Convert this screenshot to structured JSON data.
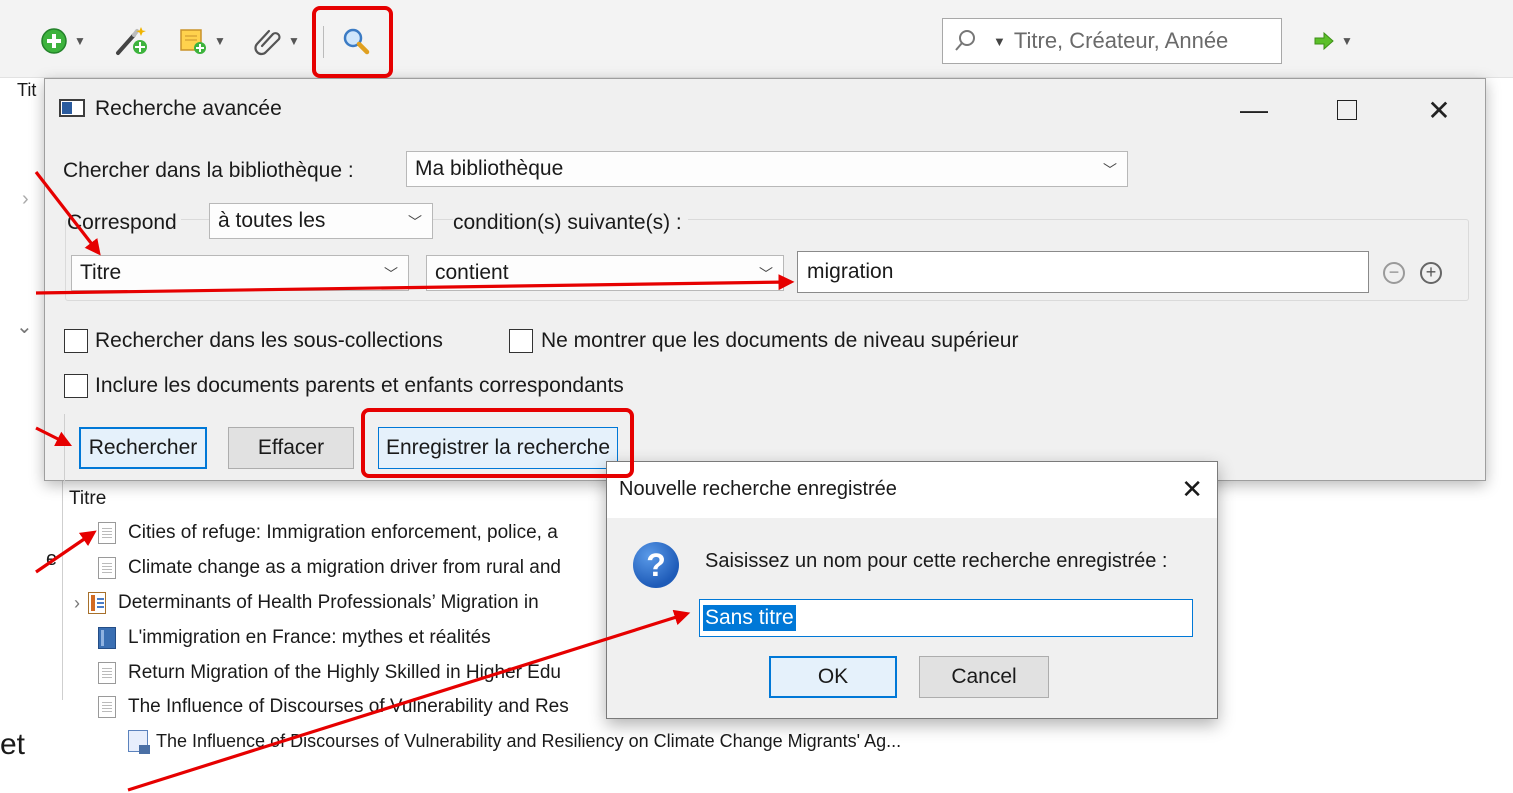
{
  "toolbar": {
    "search_placeholder": "Titre, Créateur, Année",
    "icons": [
      "new-item-icon",
      "magic-wand-icon",
      "new-note-icon",
      "attachment-icon",
      "advanced-search-icon",
      "search-mode-icon",
      "sync-arrow-icon"
    ]
  },
  "background": {
    "column_title_fragment": "Tit",
    "left_fragment_e": "e",
    "left_fragment_et": "et",
    "items_header": "Titre",
    "items": [
      {
        "title": "Cities of refuge: Immigration enforcement, police, a",
        "icon": "document-icon"
      },
      {
        "title": "Climate change as a migration driver from rural and",
        "icon": "document-icon"
      },
      {
        "title": "Determinants of Health Professionals’ Migration in",
        "icon": "multi-doc-icon"
      },
      {
        "title": "L'immigration en France: mythes et réalités",
        "icon": "book-icon"
      },
      {
        "title": "Return Migration of the Highly Skilled in Higher Edu",
        "icon": "document-icon"
      },
      {
        "title": "The Influence of Discourses of Vulnerability and Res",
        "icon": "document-icon"
      },
      {
        "title": "The Influence of Discourses of Vulnerability and Resiliency on Climate Change Migrants' Ag...",
        "icon": "pdf-attachment-icon"
      }
    ]
  },
  "advanced_search": {
    "window_title": "Recherche avancée",
    "search_in_label": "Chercher dans la bibliothèque :",
    "library_value": "Ma bibliothèque",
    "match_label": "Correspond",
    "match_value": "à toutes les",
    "conditions_label": "condition(s) suivante(s) :",
    "field_value": "Titre",
    "operator_value": "contient",
    "search_text": "migration",
    "checkbox_subcollections": "Rechercher dans les sous-collections",
    "checkbox_top_level": "Ne montrer que les documents de niveau supérieur",
    "checkbox_parents": "Inclure les documents parents et enfants correspondants",
    "search_button": "Rechercher",
    "clear_button": "Effacer",
    "save_button": "Enregistrer la recherche"
  },
  "save_dialog": {
    "title": "Nouvelle recherche enregistrée",
    "prompt": "Saisissez un nom pour cette recherche enregistrée :",
    "name_value": "Sans titre",
    "ok_button": "OK",
    "cancel_button": "Cancel"
  },
  "colors": {
    "annotation_red": "#e60000",
    "accent_blue": "#0078d7",
    "dialog_bg": "#f0f0f0"
  }
}
